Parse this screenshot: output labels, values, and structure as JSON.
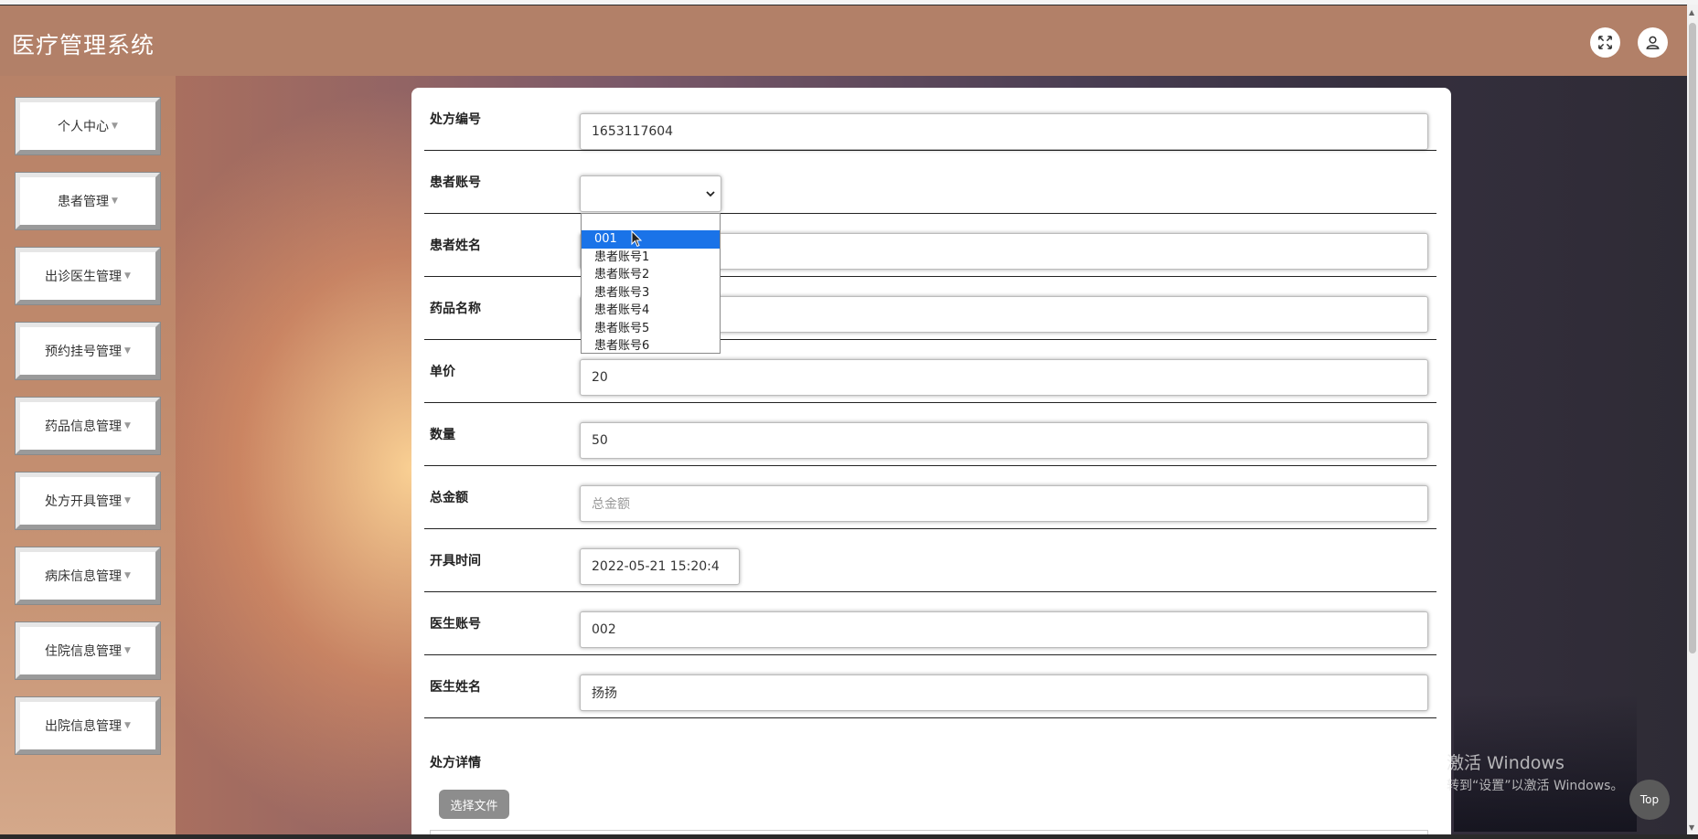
{
  "app": {
    "title": "医疗管理系统"
  },
  "header": {
    "fullscreen_icon": "fullscreen-icon",
    "user_icon": "user-icon"
  },
  "sidebar": {
    "items": [
      {
        "label": "个人中心"
      },
      {
        "label": "患者管理"
      },
      {
        "label": "出诊医生管理"
      },
      {
        "label": "预约挂号管理"
      },
      {
        "label": "药品信息管理"
      },
      {
        "label": "处方开具管理"
      },
      {
        "label": "病床信息管理"
      },
      {
        "label": "住院信息管理"
      },
      {
        "label": "出院信息管理"
      }
    ]
  },
  "form": {
    "prescription_no": {
      "label": "处方编号",
      "value": "1653117604"
    },
    "patient_account": {
      "label": "患者账号",
      "value": ""
    },
    "patient_name": {
      "label": "患者姓名"
    },
    "drug_name": {
      "label": "药品名称"
    },
    "unit_price": {
      "label": "单价",
      "value": "20"
    },
    "quantity": {
      "label": "数量",
      "value": "50"
    },
    "total": {
      "label": "总金额",
      "placeholder": "总金额"
    },
    "issue_time": {
      "label": "开具时间",
      "value": "2022-05-21 15:20:4"
    },
    "doctor_account": {
      "label": "医生账号",
      "value": "002"
    },
    "doctor_name": {
      "label": "医生姓名",
      "value": "扬扬"
    },
    "detail": {
      "label": "处方详情",
      "file_button": "选择文件"
    }
  },
  "dropdown": {
    "options": [
      "001",
      "患者账号1",
      "患者账号2",
      "患者账号3",
      "患者账号4",
      "患者账号5",
      "患者账号6"
    ],
    "highlighted": "001"
  },
  "watermark": {
    "line1": "激活 Windows",
    "line2": "转到“设置”以激活 Windows。"
  },
  "top_button": "Top"
}
